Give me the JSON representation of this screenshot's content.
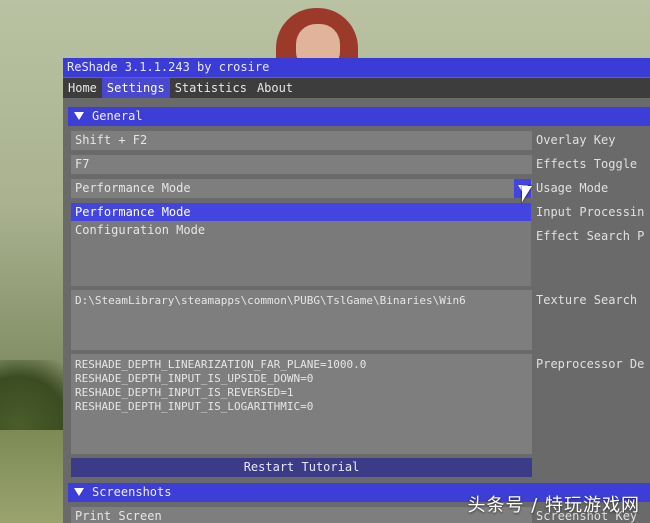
{
  "window": {
    "title": "ReShade 3.1.1.243 by crosire"
  },
  "tabs": [
    {
      "label": "Home"
    },
    {
      "label": "Settings"
    },
    {
      "label": "Statistics"
    },
    {
      "label": "About"
    }
  ],
  "active_tab": "Settings",
  "general": {
    "header": "General",
    "overlay_key": {
      "value": "Shift + F2",
      "label": "Overlay Key"
    },
    "effects_toggle": {
      "value": "F7",
      "label": "Effects Toggle"
    },
    "usage_mode": {
      "value": "Performance Mode",
      "label": "Usage Mode",
      "options": [
        "Performance Mode",
        "Configuration Mode"
      ],
      "selected": "Performance Mode"
    },
    "input_processing_label": "Input Processin",
    "effect_search_label": "Effect Search P",
    "texture_search": {
      "value": "D:\\SteamLibrary\\steamapps\\common\\PUBG\\TslGame\\Binaries\\Win6",
      "label": "Texture Search"
    },
    "preprocessor": {
      "label": "Preprocessor De",
      "lines": "RESHADE_DEPTH_LINEARIZATION_FAR_PLANE=1000.0\nRESHADE_DEPTH_INPUT_IS_UPSIDE_DOWN=0\nRESHADE_DEPTH_INPUT_IS_REVERSED=1\nRESHADE_DEPTH_INPUT_IS_LOGARITHMIC=0"
    },
    "restart_tutorial": "Restart Tutorial"
  },
  "screenshots": {
    "header": "Screenshots",
    "key": {
      "value": "Print Screen",
      "label": "Screenshot Key"
    }
  },
  "watermark": "头条号 / 特玩游戏网",
  "colors": {
    "accent": "#3b3bd8",
    "selected": "#4444e0",
    "panel": "#6a6a6a",
    "field": "#7e7e7e"
  }
}
